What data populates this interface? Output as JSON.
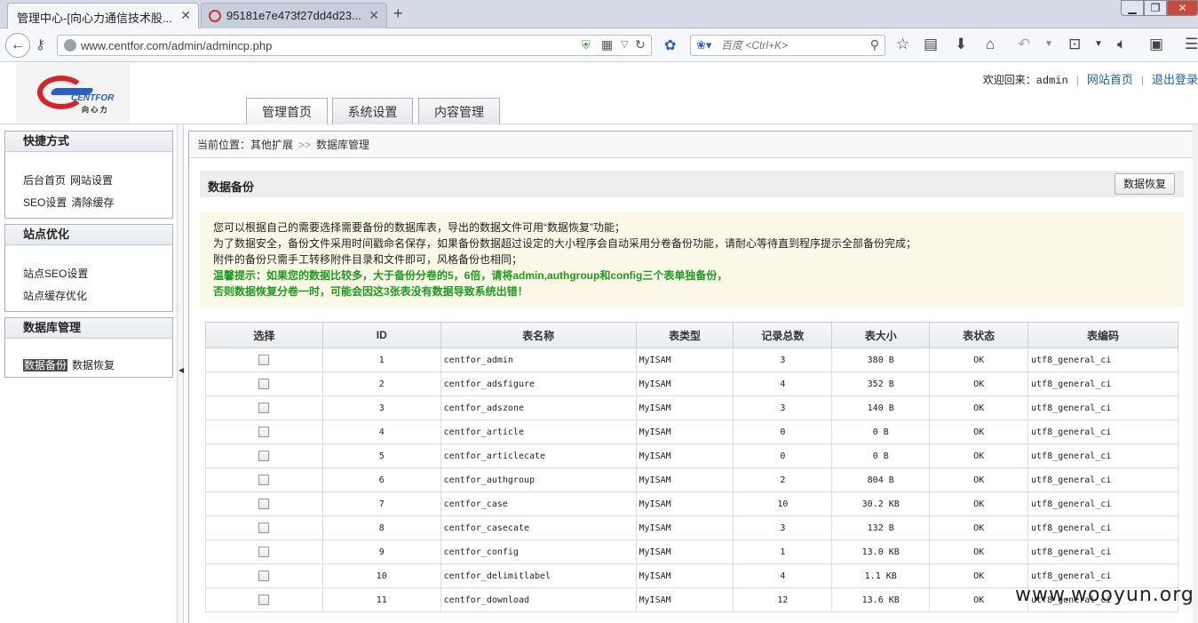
{
  "browser": {
    "tabs": [
      {
        "title": "管理中心-[向心力通信技术股..."
      },
      {
        "title": "95181e7e473f27dd4d23..."
      }
    ],
    "new_tab": "+",
    "url": "www.centfor.com/admin/admincp.php",
    "search_placeholder": "百度 <Ctrl+K>"
  },
  "header": {
    "logo_brand": "CENTFOR",
    "logo_sub": "向 心 力",
    "nav_tabs": [
      {
        "label": "管理首页"
      },
      {
        "label": "系统设置"
      },
      {
        "label": "内容管理"
      }
    ],
    "welcome": "欢迎回来：",
    "username": "admin",
    "site_home": "网站首页",
    "logout": "退出登录"
  },
  "sidebar": {
    "sections": [
      {
        "title": "快捷方式",
        "items": [
          "后台首页",
          "网站设置",
          "SEO设置",
          "清除缓存"
        ]
      },
      {
        "title": "站点优化",
        "items": [
          "站点SEO设置",
          "站点缓存优化"
        ]
      },
      {
        "title": "数据库管理",
        "items": [
          "数据备份",
          "数据恢复"
        ]
      }
    ]
  },
  "main": {
    "breadcrumb_prefix": "当前位置：",
    "breadcrumb_parent": "其他扩展",
    "breadcrumb_sep": ">>",
    "breadcrumb_current": "数据库管理",
    "panel_title": "数据备份",
    "restore_button": "数据恢复",
    "notice_lines": [
      "您可以根据自己的需要选择需要备份的数据库表，导出的数据文件可用“数据恢复”功能；",
      "为了数据安全，备份文件采用时间戳命名保存，如果备份数据超过设定的大小程序会自动采用分卷备份功能，请耐心等待直到程序提示全部备份完成；",
      "附件的备份只需手工转移附件目录和文件即可，风格备份也相同；"
    ],
    "warning_lines": [
      "温馨提示：如果您的数据比较多，大于备份分卷的5，6倍，请将admin,authgroup和config三个表单独备份，",
      "否则数据恢复分卷一时，可能会因这3张表没有数据导致系统出错！"
    ],
    "table": {
      "headers": [
        "选择",
        "ID",
        "表名称",
        "表类型",
        "记录总数",
        "表大小",
        "表状态",
        "表编码"
      ],
      "rows": [
        {
          "id": "1",
          "name": "centfor_admin",
          "type": "MyISAM",
          "count": "3",
          "size": "380 B",
          "status": "OK",
          "charset": "utf8_general_ci"
        },
        {
          "id": "2",
          "name": "centfor_adsfigure",
          "type": "MyISAM",
          "count": "4",
          "size": "352 B",
          "status": "OK",
          "charset": "utf8_general_ci"
        },
        {
          "id": "3",
          "name": "centfor_adszone",
          "type": "MyISAM",
          "count": "3",
          "size": "140 B",
          "status": "OK",
          "charset": "utf8_general_ci"
        },
        {
          "id": "4",
          "name": "centfor_article",
          "type": "MyISAM",
          "count": "0",
          "size": "0 B",
          "status": "OK",
          "charset": "utf8_general_ci"
        },
        {
          "id": "5",
          "name": "centfor_articlecate",
          "type": "MyISAM",
          "count": "0",
          "size": "0 B",
          "status": "OK",
          "charset": "utf8_general_ci"
        },
        {
          "id": "6",
          "name": "centfor_authgroup",
          "type": "MyISAM",
          "count": "2",
          "size": "804 B",
          "status": "OK",
          "charset": "utf8_general_ci"
        },
        {
          "id": "7",
          "name": "centfor_case",
          "type": "MyISAM",
          "count": "10",
          "size": "30.2 KB",
          "status": "OK",
          "charset": "utf8_general_ci"
        },
        {
          "id": "8",
          "name": "centfor_casecate",
          "type": "MyISAM",
          "count": "3",
          "size": "132 B",
          "status": "OK",
          "charset": "utf8_general_ci"
        },
        {
          "id": "9",
          "name": "centfor_config",
          "type": "MyISAM",
          "count": "1",
          "size": "13.0 KB",
          "status": "OK",
          "charset": "utf8_general_ci"
        },
        {
          "id": "10",
          "name": "centfor_delimitlabel",
          "type": "MyISAM",
          "count": "4",
          "size": "1.1 KB",
          "status": "OK",
          "charset": "utf8_general_ci"
        },
        {
          "id": "11",
          "name": "centfor_download",
          "type": "MyISAM",
          "count": "12",
          "size": "13.6 KB",
          "status": "OK",
          "charset": "utf8_general_ci"
        }
      ]
    }
  },
  "watermark": "www.wooyun.org"
}
